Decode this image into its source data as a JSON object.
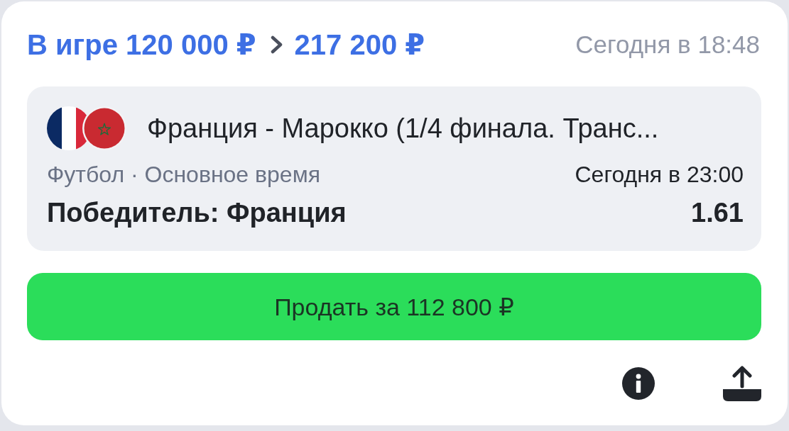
{
  "header": {
    "stake": "В игре 120 000 ₽",
    "payout": "217 200 ₽",
    "time": "Сегодня в 18:48"
  },
  "event": {
    "title": "Франция - Марокко (1/4 финала. Транс...",
    "sport": "Футбол · Основное время",
    "start_time": "Сегодня в 23:00",
    "market": "Победитель: Франция",
    "odds": "1.61"
  },
  "sell_button": {
    "label": "Продать за 112 800 ₽"
  }
}
